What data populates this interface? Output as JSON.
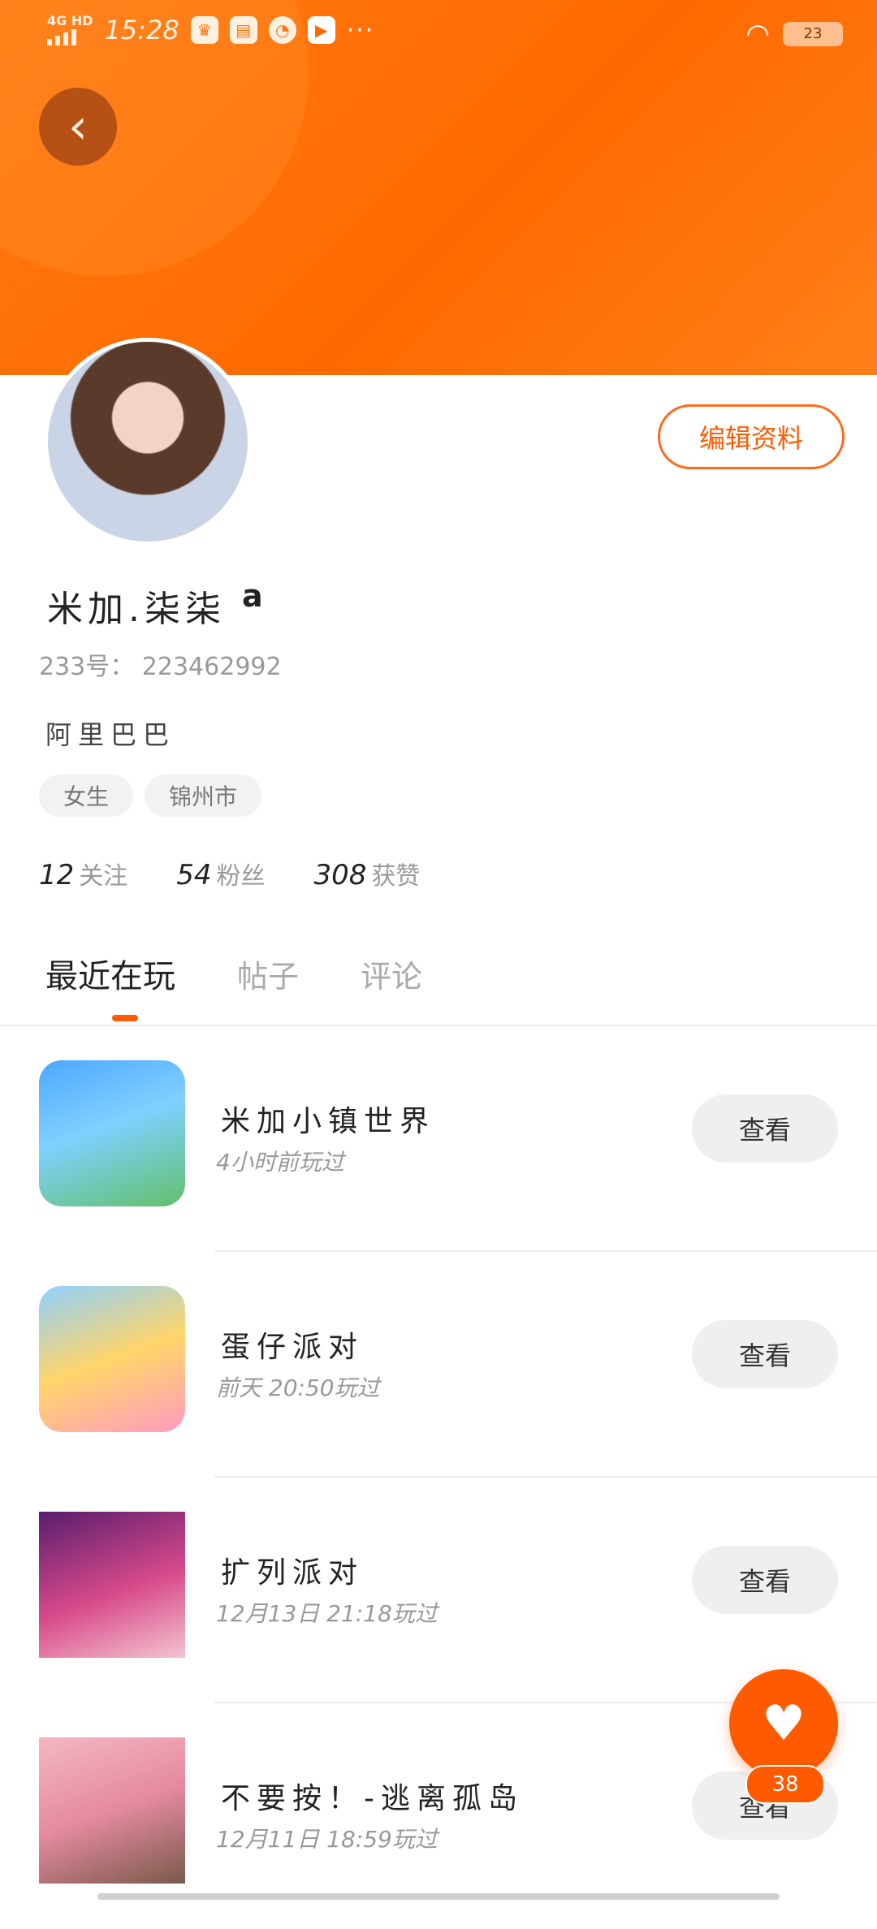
{
  "status_bar": {
    "network": "4G HD",
    "time": "15:28",
    "more": "···",
    "battery": "23"
  },
  "header": {
    "back_icon": "chevron-left-icon",
    "edit_label": "编辑资料"
  },
  "profile": {
    "username": "米加.柒柒",
    "username_suffix": "a",
    "uid": "233号： 223462992",
    "bio": "阿里巴巴",
    "tags": [
      "女生",
      "锦州市"
    ]
  },
  "stats": [
    {
      "num": "12",
      "label": "关注"
    },
    {
      "num": "54",
      "label": "粉丝"
    },
    {
      "num": "308",
      "label": "获赞"
    }
  ],
  "tabs": [
    {
      "label": "最近在玩"
    },
    {
      "label": "帖子"
    },
    {
      "label": "评论"
    }
  ],
  "games": [
    {
      "title": "米加小镇世界",
      "subtitle": "4小时前玩过",
      "button": "查看"
    },
    {
      "title": "蛋仔派对",
      "subtitle": "前天 20:50玩过",
      "button": "查看"
    },
    {
      "title": "扩列派对",
      "subtitle": "12月13日 21:18玩过",
      "button": "查看"
    },
    {
      "title": "不要按！-逃离孤岛",
      "subtitle": "12月11日 18:59玩过",
      "button": "查看"
    }
  ],
  "like": {
    "icon": "heart-icon",
    "count": "38"
  }
}
